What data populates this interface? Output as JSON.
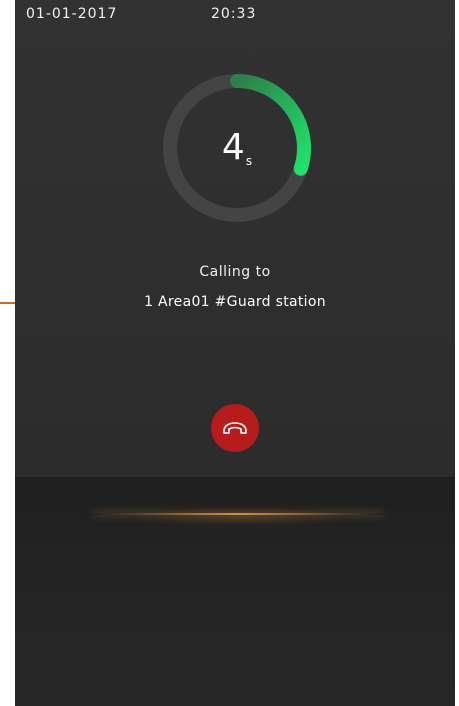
{
  "status_bar": {
    "date": "01-01-2017",
    "time": "20:33"
  },
  "timer": {
    "value": "4",
    "unit": "s",
    "progress_fraction": 0.3,
    "track_color": "#444444",
    "progress_color_start": "#2e7d4a",
    "progress_color_end": "#1ee36a"
  },
  "call": {
    "status_label": "Calling to",
    "callee": "1 Area01 #Guard station"
  },
  "controls": {
    "hangup_icon": "phone-hangup-icon",
    "hangup_color": "#b71c1c"
  },
  "annotation": {
    "color": "#d2691e"
  }
}
